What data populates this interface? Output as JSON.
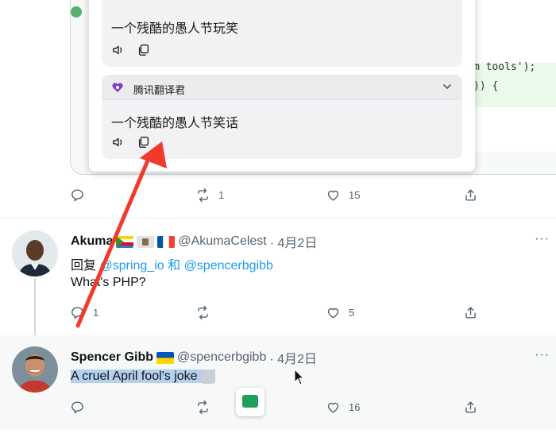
{
  "top_tweet": {
    "code_lines": [
      "m tools');",
      ")) {"
    ],
    "translation_popup": {
      "first_result": {
        "text": "一个残酷的愚人节玩笑"
      },
      "second_result": {
        "provider": "腾讯翻译君",
        "text": "一个残酷的愚人节笑话"
      }
    },
    "actions": {
      "reply_count": "",
      "retweet_count": "1",
      "like_count": "15"
    }
  },
  "reply_tweet": {
    "name": "Akuma",
    "handle": "@AkumaCelest",
    "date": "· 4月2日",
    "reply_to_prefix": "回复",
    "mention_1": "@spring_io",
    "conjunction": "和",
    "mention_2": "@spencerbgibb",
    "text": "What's PHP?",
    "actions": {
      "reply_count": "1",
      "retweet_count": "",
      "like_count": "5"
    }
  },
  "main_tweet": {
    "name": "Spencer Gibb",
    "handle": "@spencerbgibb",
    "date": "· 4月2日",
    "text": "A cruel April fool's joke",
    "actions": {
      "reply_count": "",
      "retweet_count": "",
      "like_count": "16"
    }
  },
  "more_label": "···",
  "chevron": "⌄",
  "colors": {
    "accent": "#1d9bf0",
    "annotation_arrow": "#f03a2e",
    "selection": "#b5d0ed"
  }
}
